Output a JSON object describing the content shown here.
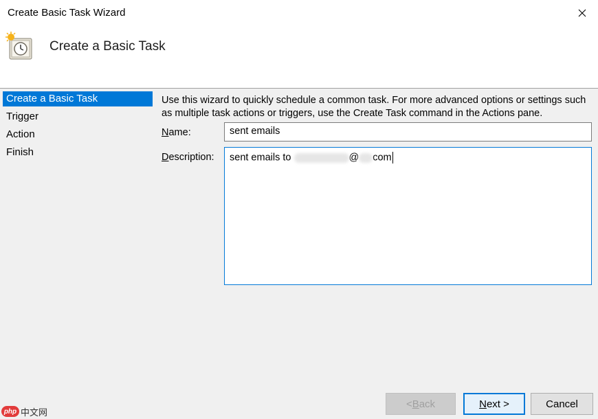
{
  "window": {
    "title": "Create Basic Task Wizard"
  },
  "header": {
    "heading": "Create a Basic Task",
    "icon": "scheduled-clock-icon"
  },
  "nav": {
    "items": [
      {
        "label": "Create a Basic Task",
        "selected": true
      },
      {
        "label": "Trigger",
        "selected": false
      },
      {
        "label": "Action",
        "selected": false
      },
      {
        "label": "Finish",
        "selected": false
      }
    ]
  },
  "main": {
    "intro": "Use this wizard to quickly schedule a common task.  For more advanced options or settings such as multiple task actions or triggers, use the Create Task command in the Actions pane.",
    "name_label": "Name:",
    "name_label_mnemonic": "N",
    "name_label_rest": "ame:",
    "name_value": "sent emails",
    "description_label_mnemonic": "D",
    "description_label_rest": "escription:",
    "description_prefix": "sent emails to ",
    "description_at": "@",
    "description_suffix": "com"
  },
  "buttons": {
    "back_mnemonic": "B",
    "back_pre": "< ",
    "back_rest": "ack",
    "back_enabled": false,
    "next_mnemonic": "N",
    "next_rest": "ext >",
    "cancel": "Cancel"
  },
  "watermark": {
    "logo": "php",
    "text": "中文网"
  },
  "colors": {
    "selection": "#0078d7",
    "panel": "#f0f0f0",
    "accent_border": "#0078d7"
  }
}
